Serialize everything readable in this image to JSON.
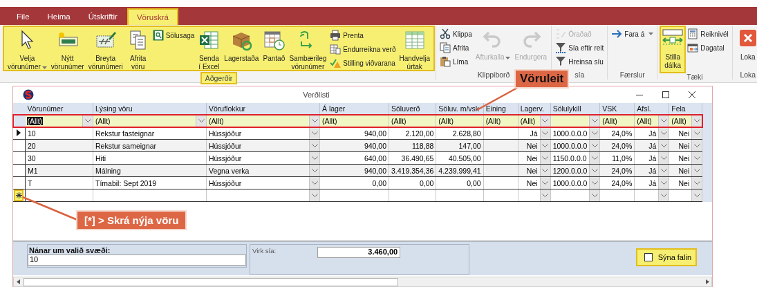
{
  "menu_tabs": [
    {
      "label": "File",
      "selected": false,
      "highlighted": false
    },
    {
      "label": "Heima",
      "selected": false,
      "highlighted": false
    },
    {
      "label": "Útskriftir",
      "selected": false,
      "highlighted": false
    },
    {
      "label": "Vöruskrá",
      "selected": true,
      "highlighted": true
    }
  ],
  "ribbon": {
    "groups": [
      {
        "label": "Aðgerðir",
        "highlighted": true,
        "items": [
          {
            "kind": "large",
            "label": "Velja\nvörunúmer",
            "dropdown": true,
            "disabled": false,
            "highlighted": false
          },
          {
            "kind": "large",
            "label": "Nýtt\nvörunúmer",
            "dropdown": false,
            "disabled": false,
            "highlighted": false
          },
          {
            "kind": "large",
            "label": "Breyta\nvörunúmeri",
            "dropdown": false,
            "disabled": false,
            "highlighted": false
          },
          {
            "kind": "large",
            "label": "Afrita\nvöru",
            "dropdown": false,
            "disabled": false,
            "highlighted": false
          },
          {
            "kind": "small",
            "label": "Sölusaga",
            "dropdown": false,
            "disabled": false,
            "highlighted": false
          },
          {
            "kind": "large",
            "label": "Senda\ní Excel",
            "dropdown": false,
            "disabled": false,
            "highlighted": false
          },
          {
            "kind": "large",
            "label": "Lagerstaða",
            "dropdown": false,
            "disabled": false,
            "highlighted": false
          },
          {
            "kind": "large",
            "label": "Pantað",
            "dropdown": false,
            "disabled": false,
            "highlighted": false
          },
          {
            "kind": "large",
            "label": "Sambærileg\nvörunúmer",
            "dropdown": false,
            "disabled": false,
            "highlighted": false
          },
          {
            "kind": "small",
            "label": "Prenta",
            "dropdown": false,
            "disabled": false,
            "highlighted": false
          },
          {
            "kind": "small",
            "label": "Endurreikna verð",
            "dropdown": false,
            "disabled": false,
            "highlighted": false
          },
          {
            "kind": "small",
            "label": "Stilling viðvarana",
            "dropdown": false,
            "disabled": false,
            "highlighted": false
          },
          {
            "kind": "large",
            "label": "Handvelja\núrtak",
            "dropdown": false,
            "disabled": false,
            "highlighted": false
          }
        ]
      },
      {
        "label": "Klippiborð",
        "highlighted": false,
        "items": [
          {
            "kind": "small",
            "label": "Klippa",
            "dropdown": false,
            "disabled": false,
            "highlighted": false
          },
          {
            "kind": "small",
            "label": "Afrita",
            "dropdown": false,
            "disabled": false,
            "highlighted": false
          },
          {
            "kind": "small",
            "label": "Líma",
            "dropdown": false,
            "disabled": false,
            "highlighted": false
          },
          {
            "kind": "large",
            "label": "Afturkalla",
            "dropdown": true,
            "disabled": true,
            "highlighted": false
          },
          {
            "kind": "large",
            "label": "Endurgera",
            "dropdown": false,
            "disabled": true,
            "highlighted": false
          }
        ]
      },
      {
        "label": "sía",
        "highlighted": false,
        "items": [
          {
            "kind": "small",
            "label": "Óraðað",
            "dropdown": false,
            "disabled": true,
            "highlighted": false
          },
          {
            "kind": "small",
            "label": "Sía eftir reit",
            "dropdown": false,
            "disabled": false,
            "highlighted": false
          },
          {
            "kind": "small",
            "label": "Hreinsa síu",
            "dropdown": false,
            "disabled": false,
            "highlighted": false
          }
        ]
      },
      {
        "label": "Færslur",
        "highlighted": false,
        "items": [
          {
            "kind": "small",
            "label": "Fara á",
            "dropdown": true,
            "disabled": false,
            "highlighted": false
          }
        ]
      },
      {
        "label": "Tæki",
        "highlighted": false,
        "items": [
          {
            "kind": "large",
            "label": "Stilla\ndálka",
            "dropdown": false,
            "disabled": false,
            "highlighted": true
          },
          {
            "kind": "small",
            "label": "Reiknivél",
            "dropdown": false,
            "disabled": false,
            "highlighted": false
          },
          {
            "kind": "small",
            "label": "Dagatal",
            "dropdown": false,
            "disabled": false,
            "highlighted": false
          }
        ]
      },
      {
        "label": "Loka",
        "highlighted": false,
        "items": [
          {
            "kind": "large",
            "label": "Loka",
            "dropdown": false,
            "disabled": false,
            "highlighted": false
          }
        ]
      }
    ]
  },
  "window": {
    "title": "Verðlisti"
  },
  "table": {
    "filter_highlighted": true,
    "columns": [
      {
        "label": "Vörunúmer",
        "kind": "text"
      },
      {
        "label": "Lýsing vöru",
        "kind": "text"
      },
      {
        "label": "Vöruflokkur",
        "kind": "lookup"
      },
      {
        "label": "Á lager",
        "kind": "number"
      },
      {
        "label": "Söluverð",
        "kind": "number"
      },
      {
        "label": "Söluv. m/vsk",
        "kind": "number"
      },
      {
        "label": "Eining",
        "kind": "text"
      },
      {
        "label": "Lagerv.",
        "kind": "flag"
      },
      {
        "label": "Sölulykill",
        "kind": "lookup"
      },
      {
        "label": "VSK",
        "kind": "number"
      },
      {
        "label": "Afsl.",
        "kind": "flag"
      },
      {
        "label": "Fela",
        "kind": "flag"
      }
    ],
    "filters": [
      {
        "value": "(Allt)",
        "selected": true,
        "dropdown": true
      },
      {
        "value": "(Allt)",
        "selected": false,
        "dropdown": true
      },
      {
        "value": "(Allt)",
        "selected": false,
        "dropdown": true
      },
      {
        "value": "(Allt)",
        "selected": false,
        "dropdown": false
      },
      {
        "value": "(Allt)",
        "selected": false,
        "dropdown": false
      },
      {
        "value": "(Allt)",
        "selected": false,
        "dropdown": false
      },
      {
        "value": "(Allt)",
        "selected": false,
        "dropdown": false
      },
      {
        "value": "(Allt)",
        "selected": false,
        "dropdown": true
      },
      {
        "selected": false,
        "dropdown": true
      },
      {
        "value": "(Allt)",
        "selected": false,
        "dropdown": false
      },
      {
        "value": "(Allt)",
        "selected": false,
        "dropdown": true
      },
      {
        "value": "(Allt)",
        "selected": false,
        "dropdown": true
      }
    ],
    "rows": [
      {
        "selected": true,
        "cells": [
          "10",
          "Rekstur fasteignar",
          "Hússjóður",
          "940,00",
          "2.120,00",
          "2.628,80",
          null,
          "Já",
          "1000.0.0.0",
          "24,0%",
          "Já",
          "Nei"
        ]
      },
      {
        "selected": false,
        "cells": [
          "20",
          "Rekstur sameignar",
          "Hússjóður",
          "940,00",
          "118,88",
          "147,00",
          null,
          "Nei",
          "1000.0.0.0",
          "24,0%",
          "Já",
          "Nei"
        ]
      },
      {
        "selected": false,
        "cells": [
          "30",
          "Hiti",
          "Hússjóður",
          "640,00",
          "36.490,65",
          "40.505,00",
          null,
          "Nei",
          "1150.0.0.0",
          "11,0%",
          "Já",
          "Nei"
        ]
      },
      {
        "selected": false,
        "cells": [
          "M1",
          "Málning",
          "Vegna verka",
          "940,00",
          "3.419.354,36",
          "4.239.999,41",
          null,
          "Nei",
          "1200.0.0.0",
          "24,0%",
          "Já",
          "Nei"
        ]
      },
      {
        "selected": false,
        "cells": [
          "T",
          "Tímabil: Sept 2019",
          "Hússjóður",
          "0,00",
          "0,00",
          "0,00",
          null,
          "Nei",
          "1000.0.0.0",
          "24,0%",
          "Já",
          "Nei"
        ]
      }
    ],
    "new_row": {
      "highlighted": true
    }
  },
  "details": {
    "label": "Nánar um valið svæði:",
    "value": "10"
  },
  "filter_sum": {
    "label": "Virk sía:",
    "value": "3.460,00"
  },
  "show_hidden": {
    "label": "Sýna falin",
    "checked": false,
    "highlighted": true
  },
  "callouts": [
    {
      "text": "Vöruleit"
    },
    {
      "text": "[*] > Skrá nýja vöru"
    }
  ]
}
